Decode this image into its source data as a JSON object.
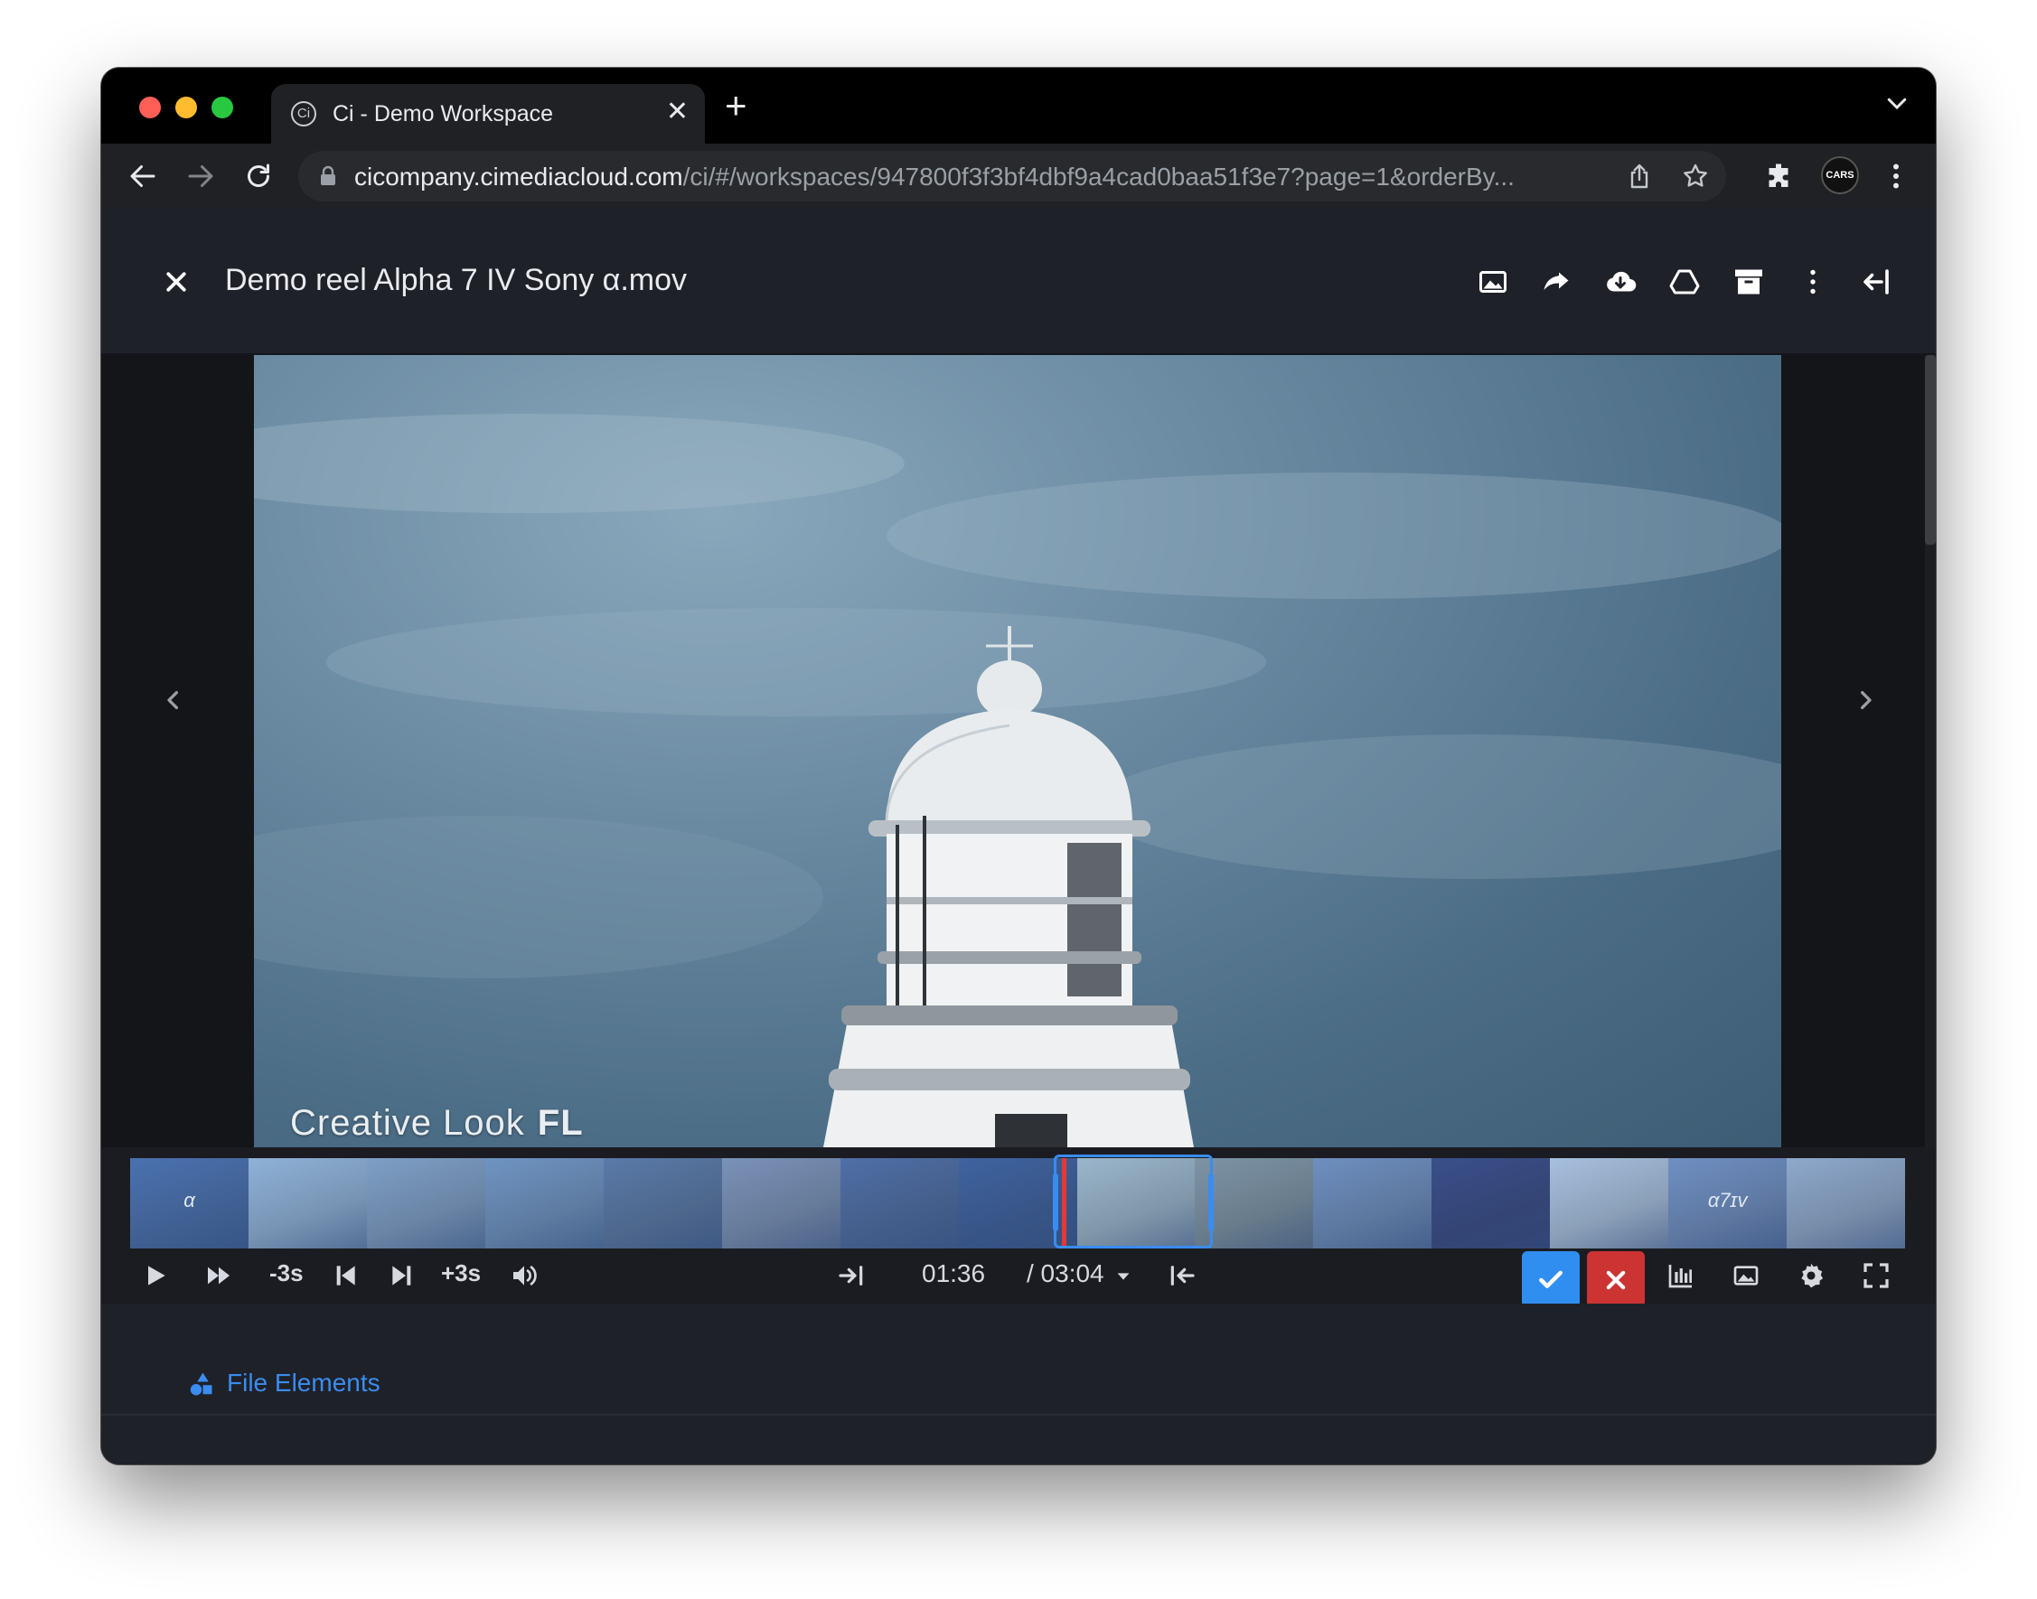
{
  "browser": {
    "tab_title": "Ci - Demo Workspace",
    "favicon_text": "Ci",
    "url_host": "cicompany.cimediacloud.com",
    "url_path": "/ci/#/workspaces/947800f3f3bf4dbf9a4cad0baa51f3e7?page=1&orderBy...",
    "profile_label": "CARS"
  },
  "header": {
    "file_title": "Demo reel Alpha 7 IV Sony α.mov"
  },
  "video": {
    "overlay_label": "Creative Look",
    "overlay_suffix": "FL"
  },
  "timeline": {
    "frames": [
      {
        "label": "α",
        "color": "#4a72b0"
      },
      {
        "label": "",
        "color": "#8fb2d8"
      },
      {
        "label": "",
        "color": "#7e9fc6"
      },
      {
        "label": "",
        "color": "#6f94c2"
      },
      {
        "label": "",
        "color": "#5a7aa8"
      },
      {
        "label": "",
        "color": "#7a92b8"
      },
      {
        "label": "",
        "color": "#4f6fa6"
      },
      {
        "label": "",
        "color": "#3f63a0"
      },
      {
        "label": "",
        "color": "#9ab6cc"
      },
      {
        "label": "",
        "color": "#7d94a6"
      },
      {
        "label": "",
        "color": "#6e8fbf"
      },
      {
        "label": "",
        "color": "#3a4f8a"
      },
      {
        "label": "",
        "color": "#a7c0de"
      },
      {
        "label": "α7ɪv",
        "color": "#6f8fc2"
      },
      {
        "label": "",
        "color": "#8ea9cc"
      }
    ]
  },
  "controls": {
    "minus_label": "-3s",
    "plus_label": "+3s",
    "current_time": "01:36",
    "duration": "/ 03:04"
  },
  "bottom_tabs": {
    "file_elements": "File Elements"
  },
  "colors": {
    "accent": "#3a8cf0",
    "danger": "#cc3333"
  }
}
